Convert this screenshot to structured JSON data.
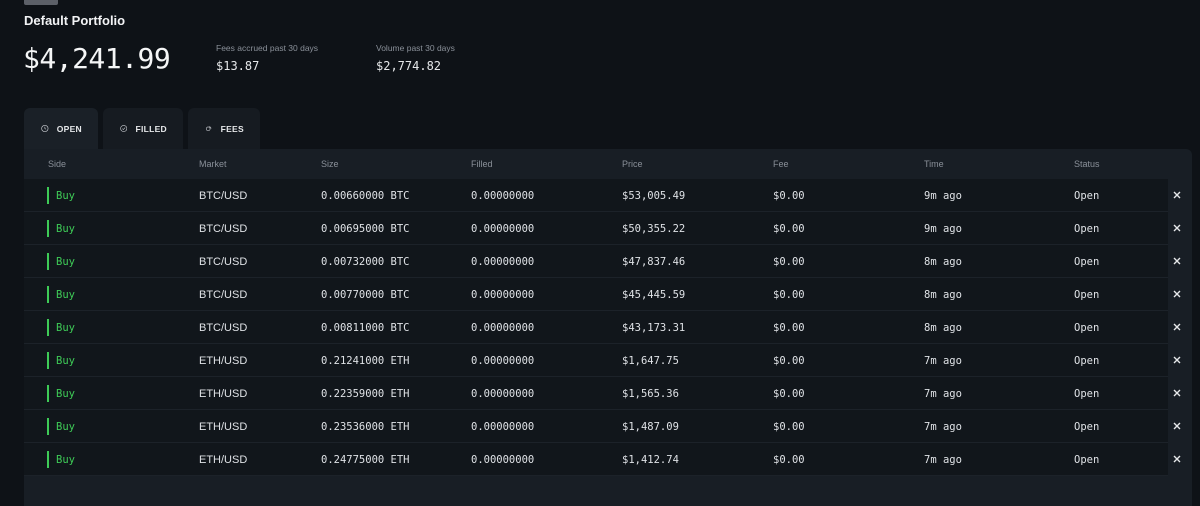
{
  "portfolio": {
    "title": "Default Portfolio",
    "balance": "$4,241.99",
    "fees_label": "Fees accrued past 30 days",
    "fees_value": "$13.87",
    "volume_label": "Volume past 30 days",
    "volume_value": "$2,774.82"
  },
  "tabs": [
    {
      "label": "OPEN",
      "icon": "clock-icon",
      "active": true
    },
    {
      "label": "FILLED",
      "icon": "check-circle-icon",
      "active": false
    },
    {
      "label": "FEES",
      "icon": "coins-icon",
      "active": false
    }
  ],
  "table": {
    "headers": [
      "Side",
      "Market",
      "Size",
      "Filled",
      "Price",
      "Fee",
      "Time",
      "Status"
    ],
    "rows": [
      {
        "side": "Buy",
        "market": "BTC/USD",
        "size": "0.00660000 BTC",
        "filled": "0.00000000",
        "price": "$53,005.49",
        "fee": "$0.00",
        "time": "9m ago",
        "status": "Open"
      },
      {
        "side": "Buy",
        "market": "BTC/USD",
        "size": "0.00695000 BTC",
        "filled": "0.00000000",
        "price": "$50,355.22",
        "fee": "$0.00",
        "time": "9m ago",
        "status": "Open"
      },
      {
        "side": "Buy",
        "market": "BTC/USD",
        "size": "0.00732000 BTC",
        "filled": "0.00000000",
        "price": "$47,837.46",
        "fee": "$0.00",
        "time": "8m ago",
        "status": "Open"
      },
      {
        "side": "Buy",
        "market": "BTC/USD",
        "size": "0.00770000 BTC",
        "filled": "0.00000000",
        "price": "$45,445.59",
        "fee": "$0.00",
        "time": "8m ago",
        "status": "Open"
      },
      {
        "side": "Buy",
        "market": "BTC/USD",
        "size": "0.00811000 BTC",
        "filled": "0.00000000",
        "price": "$43,173.31",
        "fee": "$0.00",
        "time": "8m ago",
        "status": "Open"
      },
      {
        "side": "Buy",
        "market": "ETH/USD",
        "size": "0.21241000 ETH",
        "filled": "0.00000000",
        "price": "$1,647.75",
        "fee": "$0.00",
        "time": "7m ago",
        "status": "Open"
      },
      {
        "side": "Buy",
        "market": "ETH/USD",
        "size": "0.22359000 ETH",
        "filled": "0.00000000",
        "price": "$1,565.36",
        "fee": "$0.00",
        "time": "7m ago",
        "status": "Open"
      },
      {
        "side": "Buy",
        "market": "ETH/USD",
        "size": "0.23536000 ETH",
        "filled": "0.00000000",
        "price": "$1,487.09",
        "fee": "$0.00",
        "time": "7m ago",
        "status": "Open"
      },
      {
        "side": "Buy",
        "market": "ETH/USD",
        "size": "0.24775000 ETH",
        "filled": "0.00000000",
        "price": "$1,412.74",
        "fee": "$0.00",
        "time": "7m ago",
        "status": "Open"
      }
    ],
    "cancel_icon": "close-icon"
  },
  "colors": {
    "background": "#0e1217",
    "panel": "#181e25",
    "buy": "#3ecb57",
    "muted_text": "#8a9099"
  }
}
